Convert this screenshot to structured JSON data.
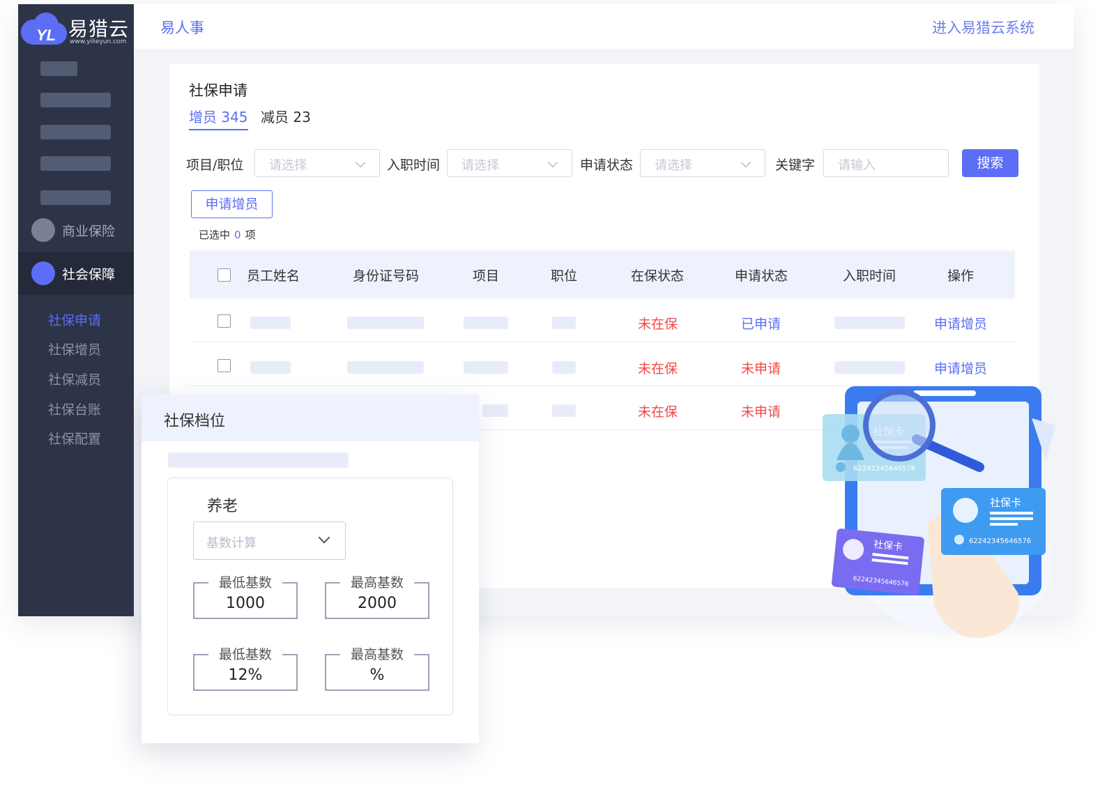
{
  "brand": {
    "name": "易猎云",
    "url": "www.yilieyun.com",
    "mark": "YL"
  },
  "topbar": {
    "title": "易人事",
    "link": "进入易猎云系统"
  },
  "sidebar": {
    "groups": [
      {
        "label": "商业保险"
      },
      {
        "label": "社会保障"
      }
    ],
    "sub_items": [
      "社保申请",
      "社保增员",
      "社保减员",
      "社保台账",
      "社保配置"
    ]
  },
  "card": {
    "title": "社保申请",
    "tabs": [
      {
        "label": "增员 345"
      },
      {
        "label": "减员 23"
      }
    ],
    "filters": [
      {
        "label": "项目/职位",
        "placeholder": "请选择"
      },
      {
        "label": "入职时间",
        "placeholder": "请选择"
      },
      {
        "label": "申请状态",
        "placeholder": "请选择"
      },
      {
        "label": "关键字",
        "placeholder": "请输入"
      }
    ],
    "search_label": "搜索",
    "apply_label": "申请增员",
    "selected_prefix": "已选中",
    "selected_count": "0",
    "selected_suffix": "项",
    "columns": [
      "员工姓名",
      "身份证号码",
      "项目",
      "职位",
      "在保状态",
      "申请状态",
      "入职时间",
      "操作"
    ],
    "rows": [
      {
        "insured_status": "未在保",
        "apply_status": "已申请",
        "action": "申请增员"
      },
      {
        "insured_status": "未在保",
        "apply_status": "未申请",
        "action": "申请增员"
      },
      {
        "insured_status": "未在保",
        "apply_status": "未申请",
        "action": ""
      }
    ]
  },
  "panel": {
    "title": "社保档位",
    "section": "养老",
    "calc_placeholder": "基数计算",
    "fields": [
      {
        "legend": "最低基数",
        "value": "1000"
      },
      {
        "legend": "最高基数",
        "value": "2000"
      },
      {
        "legend": "最低基数",
        "value": "12%"
      },
      {
        "legend": "最高基数",
        "value": "%"
      }
    ]
  },
  "illustration": {
    "card_label": "社保卡",
    "card_number": "62242345646576"
  },
  "colors": {
    "accent": "#5b6ef5",
    "sidebar": "#2e3447",
    "danger": "#f04848"
  }
}
